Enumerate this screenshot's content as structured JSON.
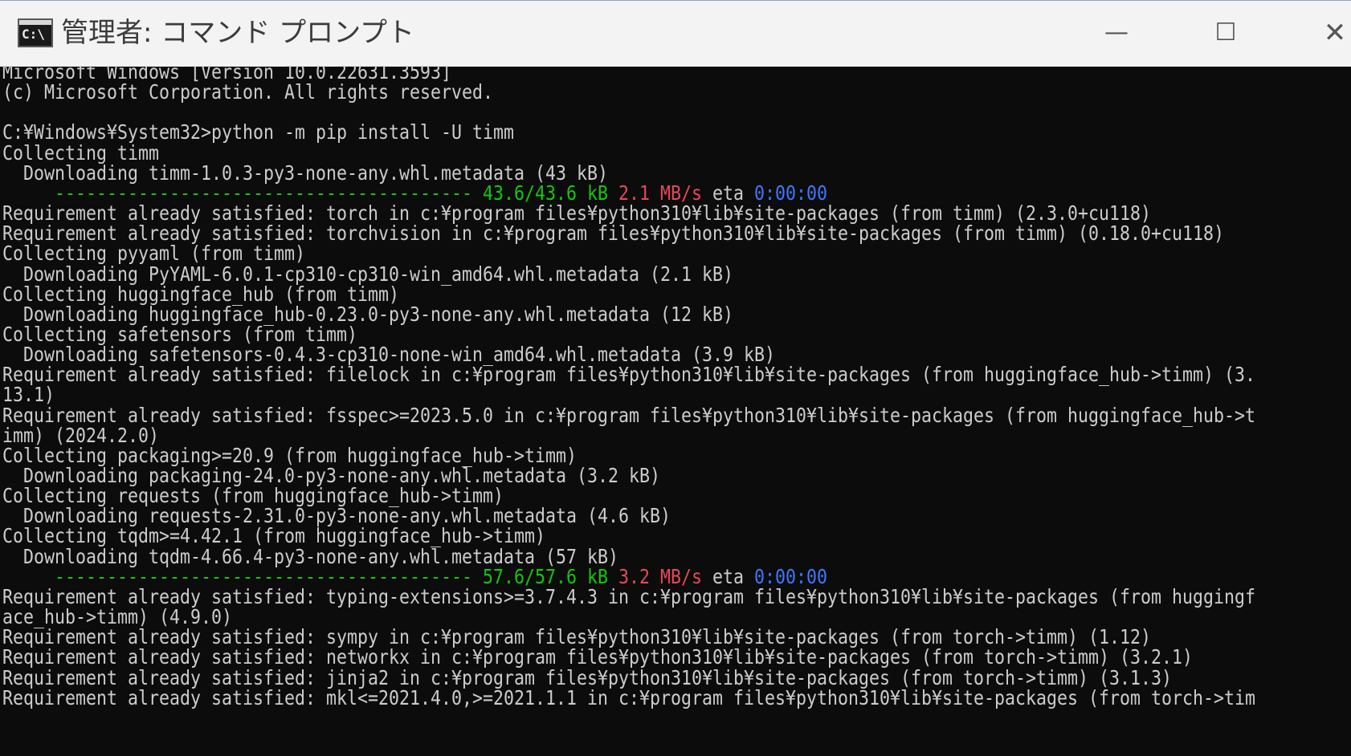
{
  "window": {
    "title": "管理者: コマンド プロンプト",
    "icon_text": "C:\\",
    "minimize_glyph": "—",
    "maximize_glyph": "☐",
    "close_glyph": "✕"
  },
  "colors": {
    "background": "#0c0c0c",
    "text": "#cccccc",
    "progress_green": "#16c60c",
    "speed_red": "#e74856",
    "eta_blue": "#3b78ff"
  },
  "console": {
    "lines": [
      "Microsoft Windows [Version 10.0.22631.3593]",
      "(c) Microsoft Corporation. All rights reserved.",
      "",
      "C:¥Windows¥System32>python -m pip install -U timm",
      "Collecting timm",
      "  Downloading timm-1.0.3-py3-none-any.whl.metadata (43 kB)",
      "",
      "Requirement already satisfied: torch in c:¥program files¥python310¥lib¥site-packages (from timm) (2.3.0+cu118)",
      "Requirement already satisfied: torchvision in c:¥program files¥python310¥lib¥site-packages (from timm) (0.18.0+cu118)",
      "Collecting pyyaml (from timm)",
      "  Downloading PyYAML-6.0.1-cp310-cp310-win_amd64.whl.metadata (2.1 kB)",
      "Collecting huggingface_hub (from timm)",
      "  Downloading huggingface_hub-0.23.0-py3-none-any.whl.metadata (12 kB)",
      "Collecting safetensors (from timm)",
      "  Downloading safetensors-0.4.3-cp310-none-win_amd64.whl.metadata (3.9 kB)",
      "Requirement already satisfied: filelock in c:¥program files¥python310¥lib¥site-packages (from huggingface_hub->timm) (3.",
      "13.1)",
      "Requirement already satisfied: fsspec>=2023.5.0 in c:¥program files¥python310¥lib¥site-packages (from huggingface_hub->t",
      "imm) (2024.2.0)",
      "Collecting packaging>=20.9 (from huggingface_hub->timm)",
      "  Downloading packaging-24.0-py3-none-any.whl.metadata (3.2 kB)",
      "Collecting requests (from huggingface_hub->timm)",
      "  Downloading requests-2.31.0-py3-none-any.whl.metadata (4.6 kB)",
      "Collecting tqdm>=4.42.1 (from huggingface_hub->timm)",
      "  Downloading tqdm-4.66.4-py3-none-any.whl.metadata (57 kB)",
      "",
      "Requirement already satisfied: typing-extensions>=3.7.4.3 in c:¥program files¥python310¥lib¥site-packages (from huggingf",
      "ace_hub->timm) (4.9.0)",
      "Requirement already satisfied: sympy in c:¥program files¥python310¥lib¥site-packages (from torch->timm) (1.12)",
      "Requirement already satisfied: networkx in c:¥program files¥python310¥lib¥site-packages (from torch->timm) (3.2.1)",
      "Requirement already satisfied: jinja2 in c:¥program files¥python310¥lib¥site-packages (from torch->timm) (3.1.3)",
      "Requirement already satisfied: mkl<=2021.4.0,>=2021.1.1 in c:¥program files¥python310¥lib¥site-packages (from torch->tim"
    ],
    "progress1": {
      "bar": "----------------------------------------",
      "size": "43.6/43.6 kB",
      "speed": "2.1 MB/s",
      "eta_label": "eta",
      "eta": "0:00:00"
    },
    "progress2": {
      "bar": "----------------------------------------",
      "size": "57.6/57.6 kB",
      "speed": "3.2 MB/s",
      "eta_label": "eta",
      "eta": "0:00:00"
    }
  }
}
